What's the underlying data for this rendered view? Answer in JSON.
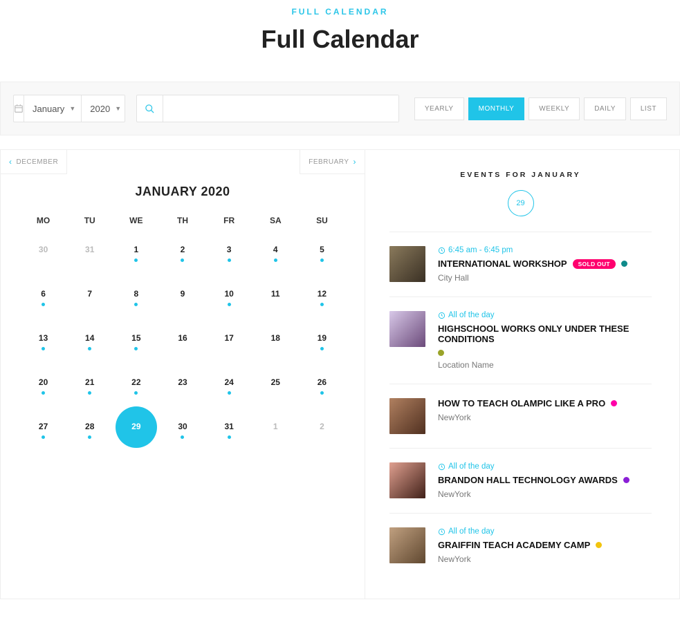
{
  "header": {
    "eyebrow": "FULL CALENDAR",
    "title": "Full Calendar"
  },
  "toolbar": {
    "month": "January",
    "year": "2020",
    "views": [
      "YEARLY",
      "MONTHLY",
      "WEEKLY",
      "DAILY",
      "LIST"
    ],
    "active_view": "MONTHLY"
  },
  "calendar": {
    "prev": "DECEMBER",
    "next": "FEBRUARY",
    "title": "JANUARY 2020",
    "weekdays": [
      "MO",
      "TU",
      "WE",
      "TH",
      "FR",
      "SA",
      "SU"
    ],
    "cells": [
      {
        "n": "30",
        "muted": true
      },
      {
        "n": "31",
        "muted": true
      },
      {
        "n": "1",
        "dot": true
      },
      {
        "n": "2",
        "dot": true
      },
      {
        "n": "3",
        "dot": true
      },
      {
        "n": "4",
        "dot": true
      },
      {
        "n": "5",
        "dot": true
      },
      {
        "n": "6",
        "dot": true
      },
      {
        "n": "7"
      },
      {
        "n": "8",
        "dot": true
      },
      {
        "n": "9"
      },
      {
        "n": "10",
        "dot": true
      },
      {
        "n": "11"
      },
      {
        "n": "12",
        "dot": true
      },
      {
        "n": "13",
        "dot": true
      },
      {
        "n": "14",
        "dot": true
      },
      {
        "n": "15",
        "dot": true
      },
      {
        "n": "16"
      },
      {
        "n": "17"
      },
      {
        "n": "18"
      },
      {
        "n": "19",
        "dot": true
      },
      {
        "n": "20",
        "dot": true
      },
      {
        "n": "21",
        "dot": true
      },
      {
        "n": "22",
        "dot": true
      },
      {
        "n": "23"
      },
      {
        "n": "24",
        "dot": true
      },
      {
        "n": "25"
      },
      {
        "n": "26",
        "dot": true
      },
      {
        "n": "27",
        "dot": true
      },
      {
        "n": "28",
        "dot": true
      },
      {
        "n": "29",
        "selected": true
      },
      {
        "n": "30",
        "dot": true
      },
      {
        "n": "31",
        "dot": true
      },
      {
        "n": "1",
        "muted": true
      },
      {
        "n": "2",
        "muted": true
      }
    ]
  },
  "events": {
    "heading": "EVENTS FOR JANUARY",
    "date": "29",
    "list": [
      {
        "time": "6:45 am - 6:45 pm",
        "title": "INTERNATIONAL WORKSHOP",
        "badge": "SOLD OUT",
        "color": "#0e8a8a",
        "loc": "City Hall",
        "thumb": "th1"
      },
      {
        "time": "All of the day",
        "title": "HIGHSCHOOL WORKS ONLY UNDER THESE CONDITIONS",
        "color": "#9aa328",
        "loc": "Location Name",
        "thumb": "th2"
      },
      {
        "time": "",
        "title": "HOW TO TEACH OLAMPIC LIKE A PRO",
        "color": "#ff00a8",
        "loc": "NewYork",
        "thumb": "th3"
      },
      {
        "time": "All of the day",
        "title": "BRANDON HALL TECHNOLOGY AWARDS",
        "color": "#8a1fd6",
        "loc": "NewYork",
        "thumb": "th4"
      },
      {
        "time": "All of the day",
        "title": "GRAIFFIN TEACH ACADEMY CAMP",
        "color": "#f2c40e",
        "loc": "NewYork",
        "thumb": "th5"
      }
    ]
  }
}
